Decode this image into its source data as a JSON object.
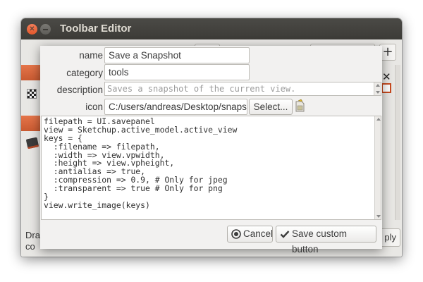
{
  "window": {
    "title": "Toolbar Editor",
    "add_symbol": "+",
    "bottom_text_line1": "Dra",
    "bottom_text_line2": "co",
    "apply_fragment": "ply"
  },
  "dialog": {
    "fields": {
      "name": {
        "label": "name",
        "value": "Save a Snapshot"
      },
      "category": {
        "label": "category",
        "value": "tools"
      },
      "description": {
        "label": "description",
        "placeholder": "Saves a snapshot of the current view."
      },
      "icon": {
        "label": "icon",
        "value": "C:/users/andreas/Desktop/snapsh"
      }
    },
    "select_label": "Select...",
    "code_lines": [
      "filepath = UI.savepanel",
      "view = Sketchup.active_model.active_view",
      "keys = {",
      "  :filename => filepath,",
      "  :width => view.vpwidth,",
      "  :height => view.vpheight,",
      "  :antialias => true,",
      "  :compression => 0.9, # Only for jpeg",
      "  :transparent => true # Only for png",
      "}",
      "view.write_image(keys)"
    ],
    "cancel_label": "Cancel",
    "save_label": "Save custom button"
  }
}
